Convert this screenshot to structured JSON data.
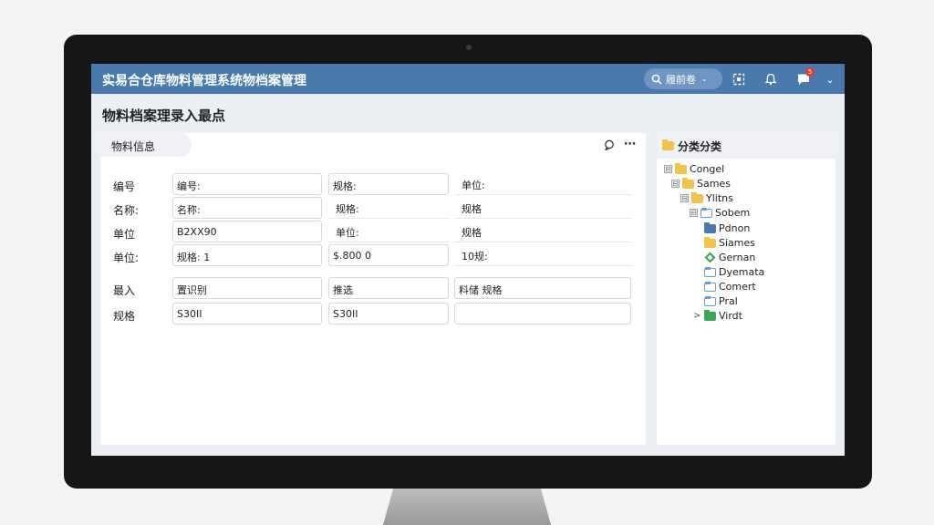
{
  "app_title": "实易合仓库物料管理系统物档案管理",
  "search": {
    "label": "履前卷"
  },
  "page_title": "物料档案理录入最点",
  "form_panel": {
    "tab_label": "物料信息",
    "rows": [
      {
        "label": "编号",
        "field1": "编号:",
        "field2": "规格:",
        "field3": "单位:"
      },
      {
        "label": "名称:",
        "field1": "名称:",
        "field2": "规格:",
        "field3": "规格"
      },
      {
        "label": "单位",
        "field1": "B2XX90",
        "field2": "单位:",
        "field3": "规格"
      },
      {
        "label": "单位:",
        "field1": "规格: 1",
        "field2": "$.800 0",
        "field3": "10规:"
      },
      {
        "label": "最入",
        "field1": "置识别",
        "field2": "推选",
        "field3": "料储 规格"
      },
      {
        "label": "规格",
        "field1": "S30II",
        "field2": "S30II",
        "field3": ""
      }
    ]
  },
  "tree_panel": {
    "title": "分类分类",
    "items": [
      {
        "label": "Congel",
        "expander": "⊟",
        "icon": "folder-yellow",
        "indent": 0
      },
      {
        "label": "Sames",
        "expander": "⊟",
        "icon": "folder-yellow",
        "indent": 1
      },
      {
        "label": "Ylitns",
        "expander": "⊟",
        "icon": "folder-yellow",
        "indent": 2
      },
      {
        "label": "Sobem",
        "expander": "⊟",
        "icon": "folder-outline",
        "indent": 3
      },
      {
        "label": "Pdnon",
        "expander": "",
        "icon": "folder-blue",
        "indent": 4
      },
      {
        "label": "Siames",
        "expander": "",
        "icon": "folder-yellow",
        "indent": 4
      },
      {
        "label": "Gernan",
        "expander": "",
        "icon": "diamond-green",
        "indent": 4
      },
      {
        "label": "Dyemata",
        "expander": "",
        "icon": "folder-outline",
        "indent": 4
      },
      {
        "label": "Comert",
        "expander": "",
        "icon": "folder-outline",
        "indent": 4
      },
      {
        "label": "Pral",
        "expander": "",
        "icon": "folder-outline",
        "indent": 4
      },
      {
        "label": "Virdt",
        "expander": ">",
        "icon": "folder-green",
        "indent": 4
      }
    ]
  },
  "notifications": {
    "badge": "5"
  },
  "colors": {
    "header": "#4a79ad",
    "folder": "#f2c24b"
  }
}
